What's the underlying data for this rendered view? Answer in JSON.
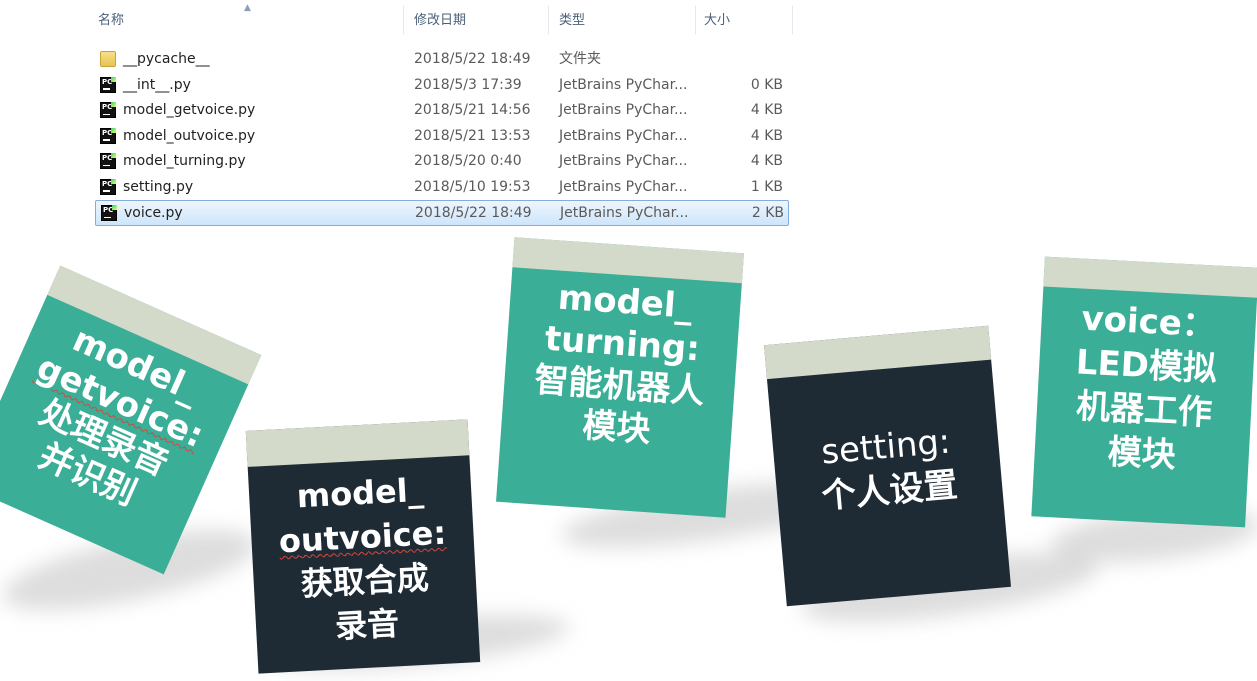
{
  "explorer": {
    "columns": {
      "name": "名称",
      "date": "修改日期",
      "type": "类型",
      "size": "大小"
    },
    "rows": [
      {
        "name": "__pycache__",
        "date": "2018/5/22 18:49",
        "type": "文件夹",
        "size": "",
        "icon": "folder-icon"
      },
      {
        "name": "__int__.py",
        "date": "2018/5/3 17:39",
        "type": "JetBrains PyChar...",
        "size": "0 KB",
        "icon": "pycharm-file-icon"
      },
      {
        "name": "model_getvoice.py",
        "date": "2018/5/21 14:56",
        "type": "JetBrains PyChar...",
        "size": "4 KB",
        "icon": "pycharm-file-icon"
      },
      {
        "name": "model_outvoice.py",
        "date": "2018/5/21 13:53",
        "type": "JetBrains PyChar...",
        "size": "4 KB",
        "icon": "pycharm-file-icon"
      },
      {
        "name": "model_turning.py",
        "date": "2018/5/20 0:40",
        "type": "JetBrains PyChar...",
        "size": "4 KB",
        "icon": "pycharm-file-icon"
      },
      {
        "name": "setting.py",
        "date": "2018/5/10 19:53",
        "type": "JetBrains PyChar...",
        "size": "1 KB",
        "icon": "pycharm-file-icon"
      },
      {
        "name": "voice.py",
        "date": "2018/5/22 18:49",
        "type": "JetBrains PyChar...",
        "size": "2 KB",
        "icon": "pycharm-file-icon",
        "selected": true
      }
    ]
  },
  "notes": {
    "getvoice": {
      "line1": "model_",
      "line2": "getvoice:",
      "line3": "处理录音",
      "line4": "并识别"
    },
    "outvoice": {
      "line1": "model_",
      "line2": "outvoice:",
      "line3": "获取合成",
      "line4": "录音"
    },
    "turning": {
      "line1": "model_",
      "line2": "turning:",
      "line3": "智能机器人",
      "line4": "模块"
    },
    "setting": {
      "line1": "setting:",
      "line2": "个人设置"
    },
    "voice": {
      "line1": "voice：",
      "line2": "LED模拟",
      "line3": "机器工作",
      "line4": "模块"
    }
  },
  "colors": {
    "teal": "#3aae96",
    "dark": "#1e2b35",
    "tab": "#d3dac9",
    "selection": "#cde5fb"
  }
}
